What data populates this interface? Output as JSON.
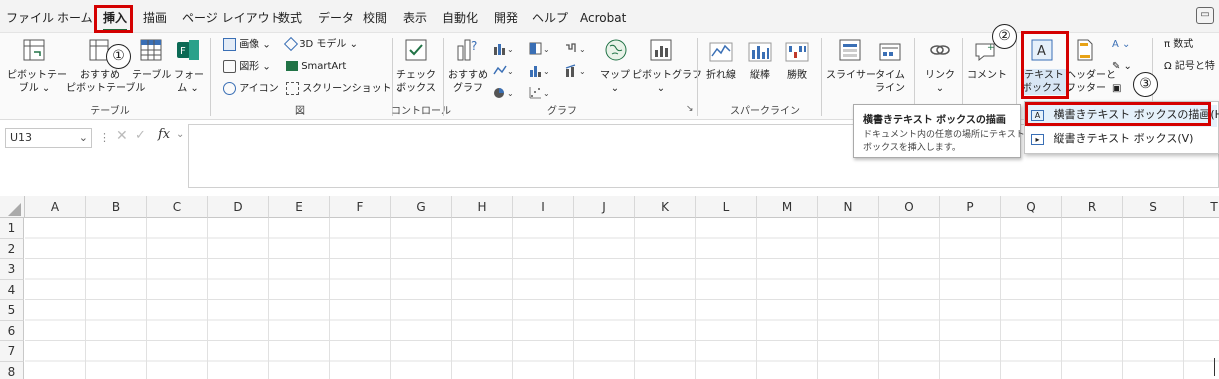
{
  "menu": {
    "tabs": [
      "ファイル",
      "ホーム",
      "挿入",
      "描画",
      "ページ レイアウト",
      "数式",
      "データ",
      "校閲",
      "表示",
      "自動化",
      "開発",
      "ヘルプ",
      "Acrobat"
    ]
  },
  "annotations": {
    "step1": "①",
    "step2": "②",
    "step3": "③"
  },
  "ribbon": {
    "table_group": {
      "pivot_l1": "ピボットテー",
      "pivot_l2": "ブル ⌄",
      "rec_l1": "おすすめ",
      "rec_l2": "ピボットテーブル",
      "table": "テーブル",
      "form_l1": "フォー",
      "form_l2": "ム ⌄",
      "label": "テーブル"
    },
    "illust_group": {
      "image": "画像 ⌄",
      "shapes": "図形 ⌄",
      "icons": "アイコン",
      "model3d": "3D モデル  ⌄",
      "smartart": "SmartArt",
      "screenshot": "スクリーンショット ⌄",
      "label": "図"
    },
    "control_group": {
      "check_l1": "チェック",
      "check_l2": "ボックス",
      "label": "コントロール"
    },
    "chart_group": {
      "rec_l1": "おすすめ",
      "rec_l2": "グラフ",
      "map_l1": "マップ",
      "map_l2": "⌄",
      "pivotchart_l1": "ピボットグラフ",
      "pivotchart_l2": "⌄",
      "label": "グラフ"
    },
    "spark_group": {
      "line": "折れ線",
      "column": "縦棒",
      "winloss": "勝敗",
      "label": "スパークライン"
    },
    "filter_group": {
      "slicer": "スライサー",
      "timeline_l1": "タイム",
      "timeline_l2": "ライン"
    },
    "link_group": {
      "link_l1": "リンク",
      "link_l2": "⌄"
    },
    "comment_group": {
      "comment": "コメント"
    },
    "text_group": {
      "textbox_l1": "テキスト",
      "textbox_l2": "ボックス ⌄",
      "header_l1": "ヘッダーと",
      "header_l2": "フッター"
    },
    "symbol_group": {
      "equation": "数式",
      "symbol": "記号と特"
    }
  },
  "tooltip": {
    "title": "横書きテキスト ボックスの描画",
    "line1": "ドキュメント内の任意の場所にテキスト",
    "line2": "ボックスを挿入します。"
  },
  "dropdown": {
    "items": [
      "横書きテキスト ボックスの描画(H)",
      "縦書きテキスト ボックス(V)"
    ]
  },
  "formula_bar": {
    "name_box": "U13",
    "fx": "fx"
  },
  "grid": {
    "columns": [
      "A",
      "B",
      "C",
      "D",
      "E",
      "F",
      "G",
      "H",
      "I",
      "J",
      "K",
      "L",
      "M",
      "N",
      "O",
      "P",
      "Q",
      "R",
      "S",
      "T"
    ],
    "rows": [
      "1",
      "2",
      "3",
      "4",
      "5",
      "6",
      "7",
      "8"
    ]
  },
  "colors": {
    "accent_green": "#1f6b3c",
    "highlight_red": "#d40000",
    "excel_green": "#217346"
  }
}
